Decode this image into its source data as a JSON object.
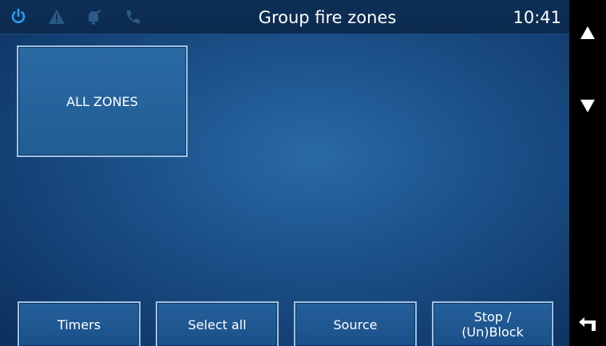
{
  "header": {
    "title": "Group fire zones",
    "time": "10:41",
    "icons": [
      "power-icon",
      "warning-icon",
      "bell-icon",
      "phone-icon"
    ]
  },
  "zones": [
    {
      "label": "ALL ZONES"
    }
  ],
  "bottom_buttons": {
    "timers": "Timers",
    "select_all": "Select all",
    "source": "Source",
    "stop_line1": "Stop /",
    "stop_line2": "(Un)Block"
  },
  "side": {
    "icons": [
      "scroll-up-icon",
      "scroll-down-icon",
      "back-icon"
    ]
  },
  "colors": {
    "accent": "#2a9df4",
    "background": "#1d548d",
    "border": "#9fc1e0"
  }
}
